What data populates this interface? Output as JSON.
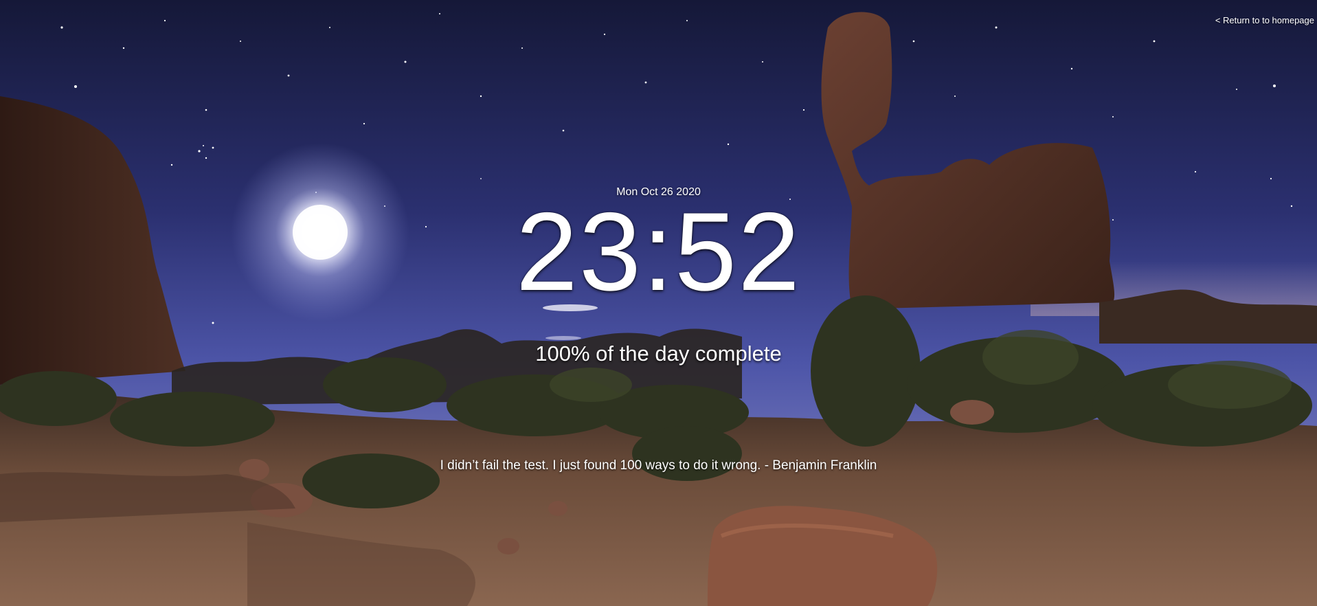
{
  "background": {
    "image_subject": "moonlit desert with balanced rock formation and starry sky",
    "sky_color_top": "#1b1f45",
    "sky_color_mid": "#4a4f9a",
    "ground_color": "#5a4030",
    "moon_color": "#ffffff"
  },
  "nav": {
    "return_label": "< Return to to homepage"
  },
  "clock": {
    "date": "Mon Oct 26 2020",
    "time": "23:52"
  },
  "day_progress": {
    "label": "100% of the day complete",
    "percent": 100
  },
  "quote": {
    "text": "I didn’t fail the test. I just found 100 ways to do it wrong. - Benjamin Franklin"
  }
}
